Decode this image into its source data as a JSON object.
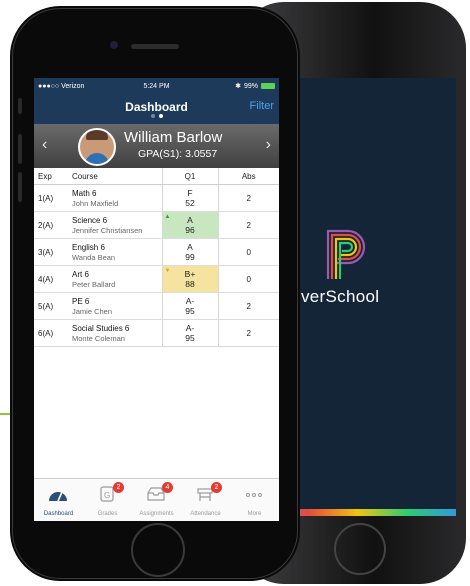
{
  "colors": {
    "accent_line": "#8cc63f",
    "badge": "#e03c31",
    "header_green": "#c8e6c0",
    "header_yellow": "#f7e3a0",
    "up_arrow": "#2e9e3e",
    "down_arrow": "#e0a21a"
  },
  "back_screen": {
    "brand_text": "verSchool"
  },
  "status_bar": {
    "carrier": "●●●○○ Verizon",
    "time": "5:24 PM",
    "battery": "99%"
  },
  "nav": {
    "title": "Dashboard",
    "filter_label": "Filter"
  },
  "student": {
    "name": "William Barlow",
    "gpa": "GPA(S1): 3.0557",
    "prev_icon": "chevron-left-icon",
    "next_icon": "chevron-right-icon"
  },
  "table": {
    "headers": {
      "exp": "Exp",
      "course": "Course",
      "q1": "Q1",
      "abs": "Abs"
    },
    "rows": [
      {
        "exp": "1(A)",
        "course": "Math 6",
        "teacher": "John Maxfield",
        "letter": "F",
        "score": "52",
        "abs": "2"
      },
      {
        "exp": "2(A)",
        "course": "Science 6",
        "teacher": "Jennifer Christiansen",
        "letter": "A",
        "score": "96",
        "abs": "2",
        "trend": "up"
      },
      {
        "exp": "3(A)",
        "course": "English 6",
        "teacher": "Wanda Bean",
        "letter": "A",
        "score": "99",
        "abs": "0"
      },
      {
        "exp": "4(A)",
        "course": "Art 6",
        "teacher": "Peter Ballard",
        "letter": "B+",
        "score": "88",
        "abs": "0",
        "trend": "down"
      },
      {
        "exp": "5(A)",
        "course": "PE 6",
        "teacher": "Jamie Chen",
        "letter": "A-",
        "score": "95",
        "abs": "2"
      },
      {
        "exp": "6(A)",
        "course": "Social Studies 6",
        "teacher": "Monte Coleman",
        "letter": "A-",
        "score": "95",
        "abs": "2"
      }
    ]
  },
  "tabbar": {
    "items": [
      {
        "label": "Dashboard",
        "icon": "gauge-icon",
        "active": true
      },
      {
        "label": "Grades",
        "icon": "grades-icon",
        "badge": "2"
      },
      {
        "label": "Assignments",
        "icon": "inbox-icon",
        "badge": "4"
      },
      {
        "label": "Attendance",
        "icon": "desk-icon",
        "badge": "2"
      },
      {
        "label": "More",
        "icon": "more-icon"
      }
    ]
  }
}
